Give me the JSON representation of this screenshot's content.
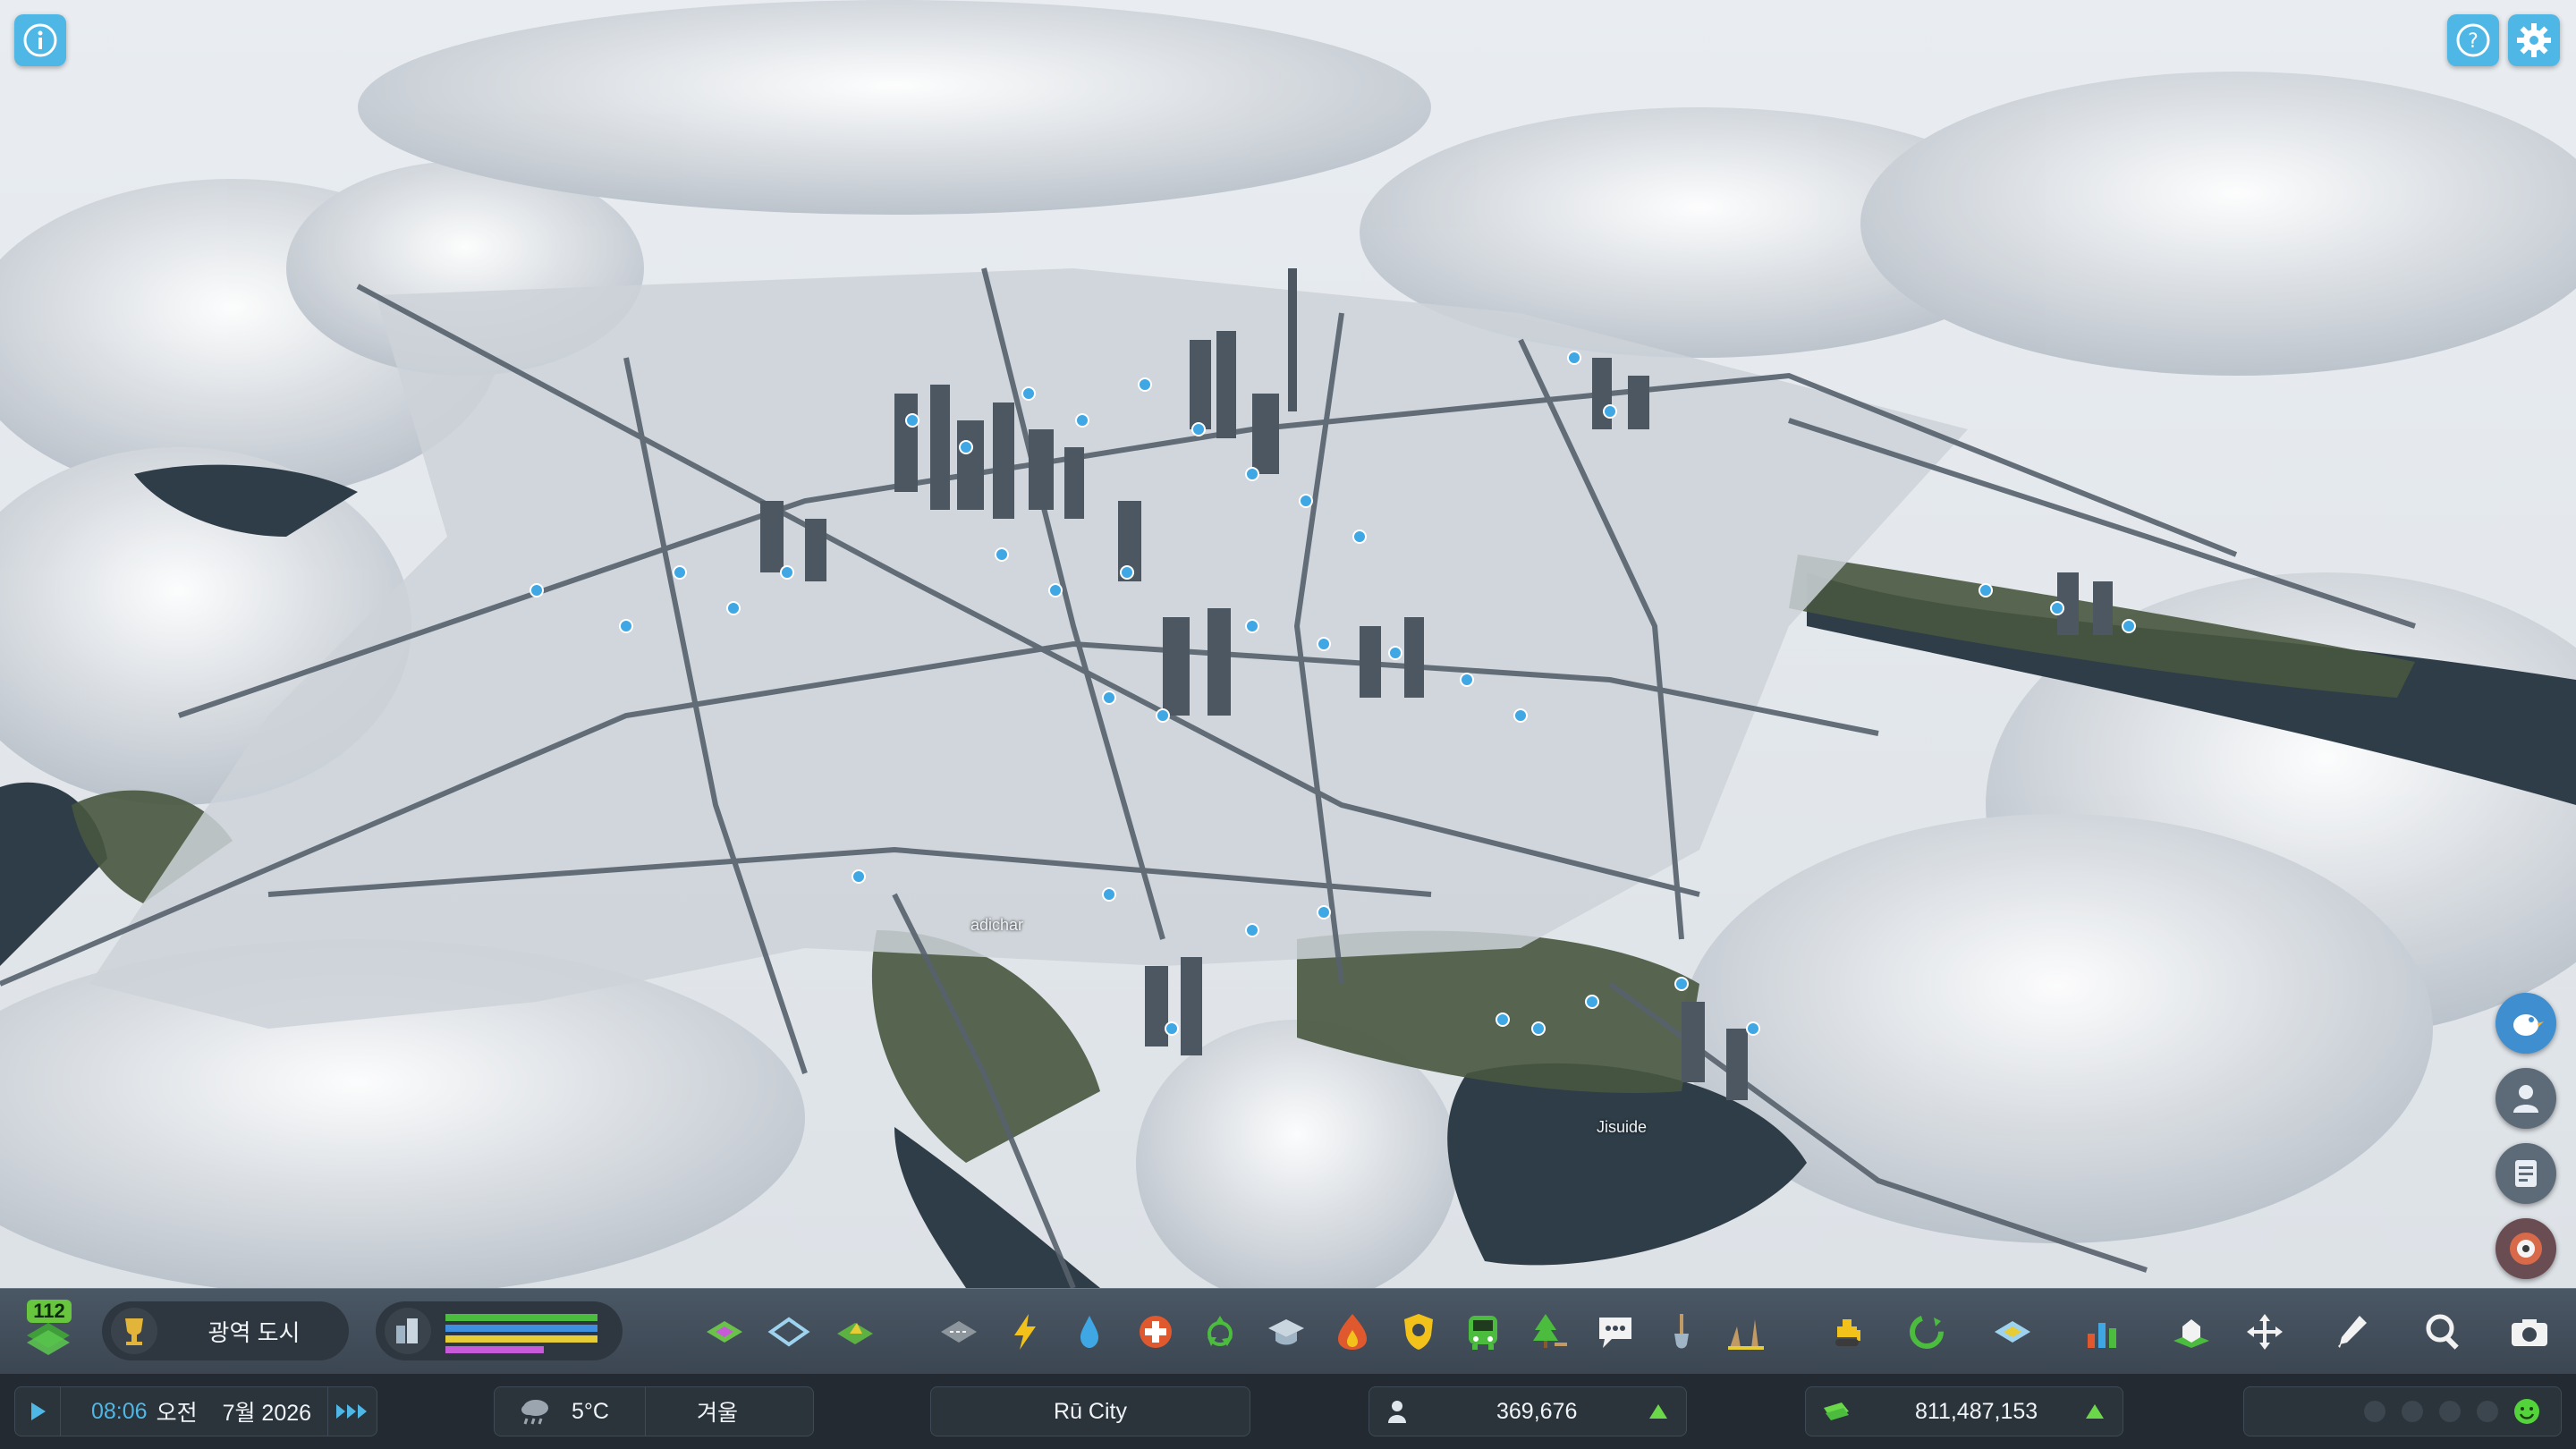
{
  "map": {
    "labels": [
      "Jisuide",
      "adichar"
    ],
    "colors": {
      "snow": "#eef1f4",
      "ground": "#c9ced4",
      "road": "#55606b",
      "building": "#4e5862",
      "water": "#2c3843",
      "grass": "#3f4c39",
      "marker": "#3fa7e3"
    }
  },
  "top_left": {
    "info_icon": "info-icon"
  },
  "top_right": {
    "help_icon": "help-icon",
    "settings_icon": "gear-icon"
  },
  "side_buttons": [
    {
      "icon": "bird-chirper-icon"
    },
    {
      "icon": "citizen-icon"
    },
    {
      "icon": "notes-icon"
    },
    {
      "icon": "radio-icon"
    }
  ],
  "toolbar": {
    "milestone_count": "112",
    "milestone_name": "광역 도시",
    "tools": [
      "zoning-icon",
      "districts-icon",
      "landscaping-icon",
      "roads-icon",
      "electricity-icon",
      "water-icon",
      "health-icon",
      "garbage-icon",
      "education-icon",
      "fire-icon",
      "police-icon",
      "transport-icon",
      "parks-icon",
      "chirper-icon",
      "shovel-icon",
      "industry-icon",
      "bulldozer-icon",
      "economy-icon",
      "map-icon",
      "stats-icon",
      "unique-buildings-icon",
      "move-icon",
      "eyedropper-icon",
      "search-icon",
      "camera-icon"
    ],
    "demand_colors": [
      "#4cbc3f",
      "#3f8fe0",
      "#e6cc35",
      "#c75ad8"
    ]
  },
  "status": {
    "play_icon": "play-icon",
    "time": "08:06",
    "ampm": "오전",
    "date": "7월 2026",
    "speed_icon": "fast-forward-icon",
    "weather_icon": "rain-cloud-icon",
    "temperature": "5°C",
    "season": "겨울",
    "city_name": "Rū City",
    "population": "369,676",
    "money": "811,487,153",
    "happiness_icons": [
      "face-icon",
      "face-icon",
      "face-icon",
      "face-icon",
      "happy-face-icon"
    ]
  }
}
